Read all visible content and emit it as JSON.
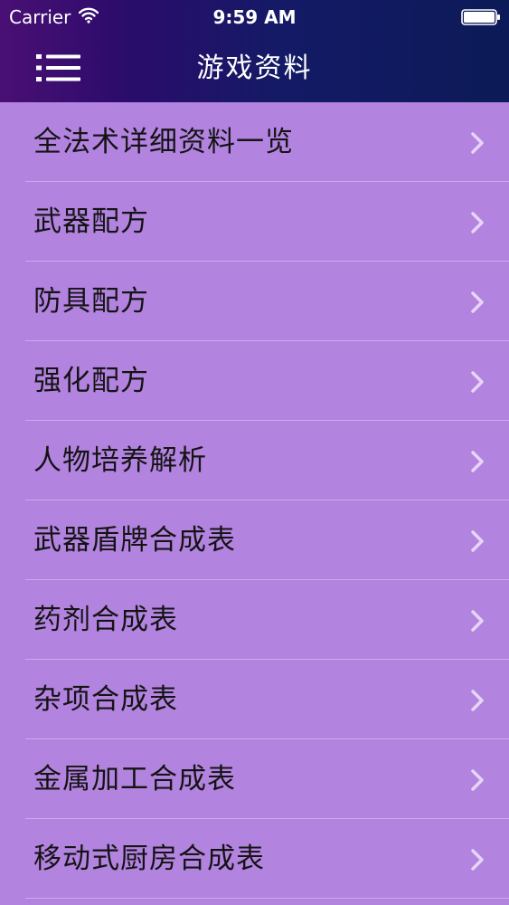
{
  "status_bar": {
    "carrier": "Carrier",
    "time": "9:59 AM",
    "icons": [
      "wifi-icon",
      "battery-icon"
    ]
  },
  "nav": {
    "title": "游戏资料",
    "menu_icon": "hamburger-menu-icon"
  },
  "list": {
    "items": [
      {
        "label": "全法术详细资料一览"
      },
      {
        "label": "武器配方"
      },
      {
        "label": "防具配方"
      },
      {
        "label": "强化配方"
      },
      {
        "label": "人物培养解析"
      },
      {
        "label": "武器盾牌合成表"
      },
      {
        "label": "药剂合成表"
      },
      {
        "label": "杂项合成表"
      },
      {
        "label": "金属加工合成表"
      },
      {
        "label": "移动式厨房合成表"
      }
    ],
    "chevron_icon": "chevron-right-icon"
  },
  "colors": {
    "background": "#b383e0",
    "header_start": "#4a0f74",
    "header_end": "#0c1a57",
    "divider": "#cfa9ec",
    "chevron": "#e7d5f7",
    "text": "#141414"
  }
}
